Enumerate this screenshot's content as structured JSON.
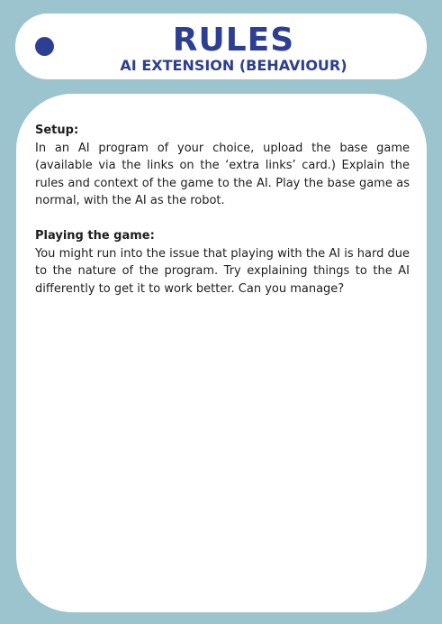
{
  "header": {
    "title": "RULES",
    "subtitle": "AI EXTENSION (BEHAVIOUR)"
  },
  "sections": [
    {
      "heading": "Setup:",
      "text": "In an AI program of your choice, upload the base game (available via the links on the ‘extra links’ card.) Explain the rules and context of the game to the AI. Play the base game as normal, with the AI as the robot."
    },
    {
      "heading": "Playing the game:",
      "text": "You might run into the issue that playing with the AI is hard due to the nature of the program. Try explaining things to the AI differently to get it to work better. Can you manage?"
    }
  ],
  "colors": {
    "background": "#9cc4cf",
    "accent": "#2d3f93",
    "card": "#ffffff",
    "text": "#1e1e1e"
  }
}
